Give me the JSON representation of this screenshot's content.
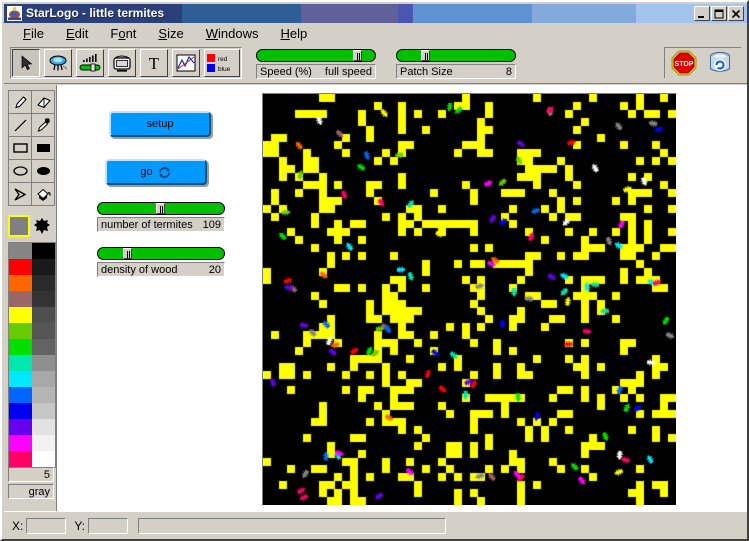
{
  "window": {
    "app_name": "StarLogo",
    "title": "StarLogo - little termites",
    "separator": "-",
    "project_name": "little termites",
    "icon": "starlogo-turtle-icon",
    "buttons": {
      "minimize": "minimize-button",
      "maximize": "maximize-button",
      "close": "close-button"
    },
    "titlebar_bands": [
      "#2b3f7a",
      "#2f5e96",
      "#61619a",
      "#4a56b0",
      "#5f92d0",
      "#84a9dc",
      "#a3c4ee"
    ]
  },
  "menu": {
    "items": [
      {
        "label": "File",
        "accel": "F"
      },
      {
        "label": "Edit",
        "accel": "E"
      },
      {
        "label": "Font",
        "accel": "o"
      },
      {
        "label": "Size",
        "accel": "S"
      },
      {
        "label": "Windows",
        "accel": "W"
      },
      {
        "label": "Help",
        "accel": "H"
      }
    ]
  },
  "toolbar": {
    "buttons": [
      {
        "name": "arrow-select-tool",
        "icon": "arrow-cursor-icon",
        "pressed": true
      },
      {
        "name": "turtle-monitor-tool",
        "icon": "turtle-icon",
        "pressed": false
      },
      {
        "name": "slider-tool",
        "icon": "slider-icon",
        "pressed": false
      },
      {
        "name": "monitor-tool",
        "icon": "tv-monitor-icon",
        "pressed": false
      },
      {
        "name": "text-tool",
        "icon": "text-t-icon",
        "pressed": false
      },
      {
        "name": "plot-tool",
        "icon": "line-plot-icon",
        "pressed": false
      },
      {
        "name": "legend-tool",
        "icon": "red-blue-legend-icon",
        "pressed": false
      }
    ],
    "legend": {
      "red_label": "red",
      "blue_label": "blue",
      "red_color": "#ff0000",
      "blue_color": "#0000ff"
    },
    "sliders": [
      {
        "name": "Speed (%)",
        "value_text": "full speed",
        "thumb_pct": 90
      },
      {
        "name": "Patch Size",
        "value_text": "8",
        "thumb_pct": 22
      }
    ],
    "right_buttons": [
      {
        "name": "stop-button",
        "icon": "stop-sign-icon",
        "label": "STOP"
      },
      {
        "name": "reset-button",
        "icon": "database-refresh-icon"
      }
    ]
  },
  "drawing_tools": [
    {
      "name": "pencil-tool",
      "icon": "pencil-icon"
    },
    {
      "name": "eraser-tool",
      "icon": "eraser-icon"
    },
    {
      "name": "line-tool",
      "icon": "line-icon"
    },
    {
      "name": "eyedropper-tool",
      "icon": "eyedropper-icon"
    },
    {
      "name": "rectangle-outline-tool",
      "icon": "rectangle-outline-icon"
    },
    {
      "name": "rectangle-filled-tool",
      "icon": "rectangle-filled-icon"
    },
    {
      "name": "ellipse-outline-tool",
      "icon": "ellipse-outline-icon"
    },
    {
      "name": "ellipse-filled-tool",
      "icon": "ellipse-filled-icon"
    },
    {
      "name": "polygon-tool",
      "icon": "polygon-icon"
    },
    {
      "name": "paint-bucket-tool",
      "icon": "paint-bucket-icon"
    }
  ],
  "color_picker": {
    "current_color": "#808080",
    "current_value": "5",
    "current_name": "gray",
    "turtle_shape_icon": "turtle-shape-icon",
    "palette_left": [
      "#858585",
      "#ff0000",
      "#ff6600",
      "#9a6666",
      "#ffff00",
      "#66cc00",
      "#00e000",
      "#00e8b0",
      "#00e8ff",
      "#0066ff",
      "#0000ee",
      "#6600ee",
      "#ff00ff",
      "#ff0066"
    ],
    "palette_right": [
      "#000000",
      "#1a1a1a",
      "#2b2b2b",
      "#333333",
      "#4f4f4f",
      "#565656",
      "#636363",
      "#8f8f8f",
      "#a8a8a8",
      "#b4b4b4",
      "#c6c6c6",
      "#e2e2e2",
      "#f2f2f2",
      "#ffffff"
    ]
  },
  "workspace": {
    "buttons": [
      {
        "name": "setup-button",
        "label": "setup",
        "forever": false
      },
      {
        "name": "go-button",
        "label": "go",
        "forever": true,
        "forever_icon": "forever-loop-icon"
      }
    ],
    "sliders": [
      {
        "name": "number of termites",
        "value_text": "109",
        "thumb_pct": 50
      },
      {
        "name": "density of wood",
        "value_text": "20",
        "thumb_pct": 22
      }
    ]
  },
  "canvas": {
    "name": "simulation-canvas",
    "background_color": "#000000",
    "wood_color": "#ffff00",
    "patch_size": 8,
    "grid_cols": 52,
    "grid_rows": 52,
    "wood_density_pct": 20,
    "termite_count": 109,
    "termite_colors": [
      "#ff0066",
      "#ff00ff",
      "#6600ee",
      "#0066ff",
      "#00e8ff",
      "#00e8b0",
      "#00e000",
      "#66cc00",
      "#ffff00",
      "#ff6600",
      "#ff0000",
      "#9a6666",
      "#858585",
      "#ffffff",
      "#0000ee"
    ]
  },
  "statusbar": {
    "x_label": "X:",
    "y_label": "Y:",
    "x_value": "",
    "y_value": "",
    "message": ""
  }
}
